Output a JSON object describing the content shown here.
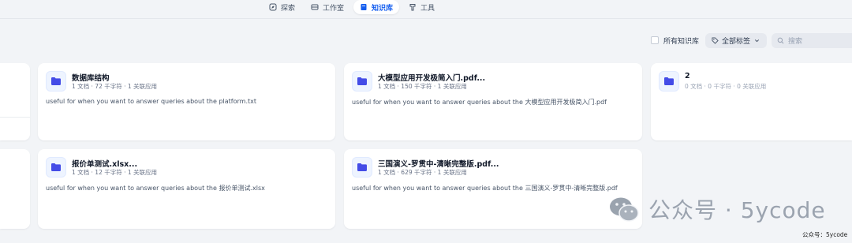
{
  "nav": {
    "items": [
      {
        "label": "探索",
        "icon": "compass-icon"
      },
      {
        "label": "工作室",
        "icon": "studio-icon"
      },
      {
        "label": "知识库",
        "icon": "book-icon",
        "active": true
      },
      {
        "label": "工具",
        "icon": "tool-icon"
      }
    ]
  },
  "filters": {
    "all_kb_label": "所有知识库",
    "tag_select_label": "全部标签",
    "search_placeholder": "搜索"
  },
  "cards": [
    {
      "title": "数据库结构",
      "meta": "1 文档 · 72 千字符 · 1 关联应用",
      "desc": "useful for when you want to answer queries about the platform.txt"
    },
    {
      "title": "大模型应用开发极简入门.pdf...",
      "meta": "1 文档 · 150 千字符 · 1 关联应用",
      "desc": "useful for when you want to answer queries about the 大模型应用开发极简入门.pdf"
    },
    {
      "title": "2",
      "meta": "0 文档 · 0 千字符 · 0 关联应用",
      "desc": ""
    },
    {
      "title": "报价单测试.xlsx...",
      "meta": "1 文档 · 12 千字符 · 1 关联应用",
      "desc": "useful for when you want to answer queries about the 报价单测试.xlsx"
    },
    {
      "title": "三国演义-罗贯中-清晰完整版.pdf...",
      "meta": "1 文档 · 629 千字符 · 1 关联应用",
      "desc": "useful for when you want to answer queries about the 三国演义-罗贯中-清晰完整版.pdf"
    }
  ],
  "watermark": {
    "text": "公众号 · 5ycode",
    "credit": "公众号：5ycode"
  },
  "colors": {
    "accent": "#155eef",
    "folder_icon": "#444ce7",
    "background": "#f2f4f7"
  }
}
